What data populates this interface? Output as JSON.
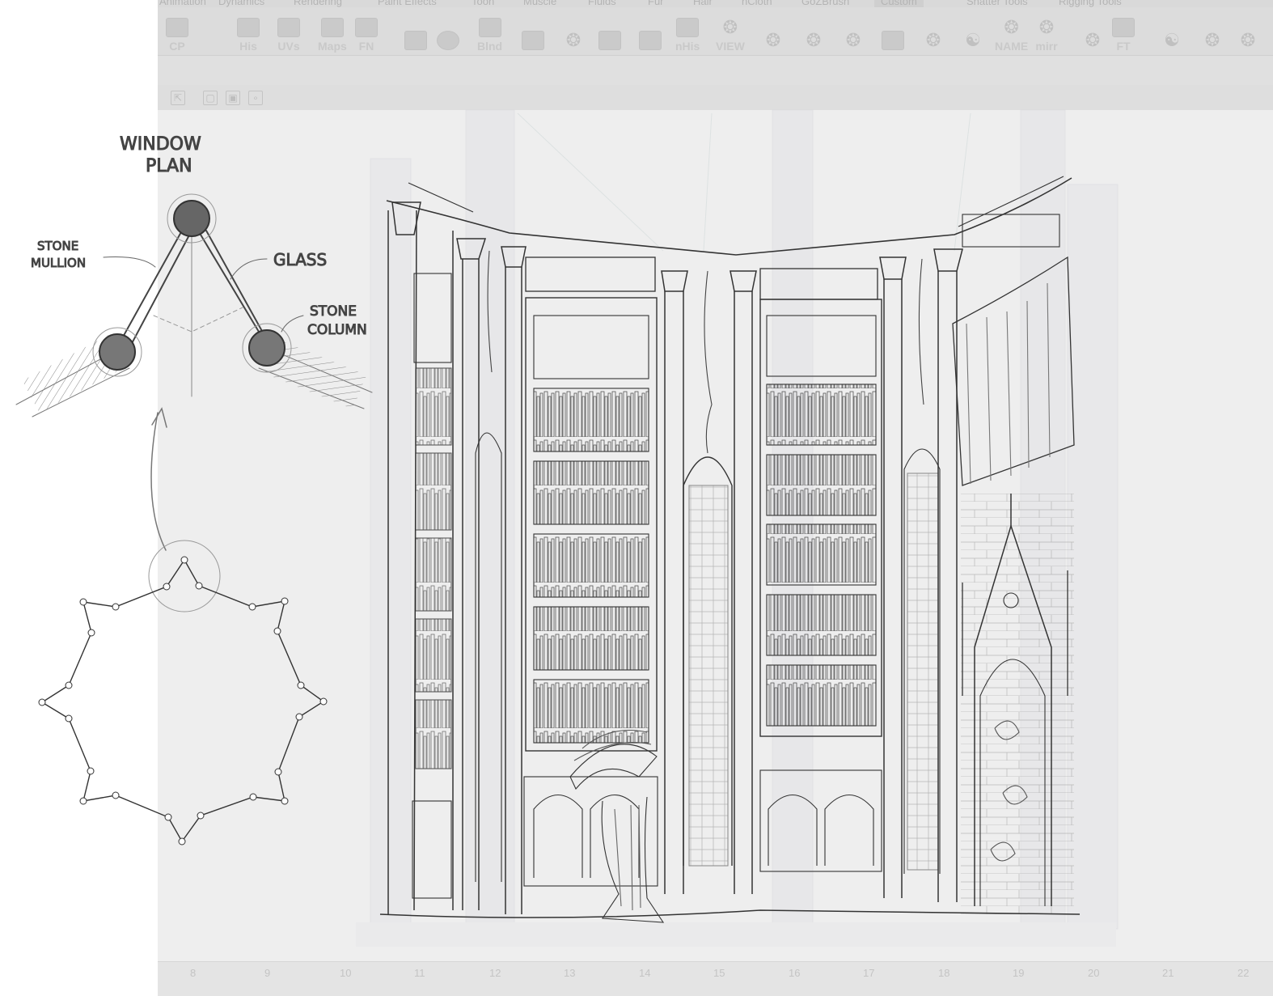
{
  "menu_tabs": [
    "Animation",
    "Dynamics",
    "Rendering",
    "Paint Effects",
    "Toon",
    "Muscle",
    "Fluids",
    "Fur",
    "Hair",
    "nCloth",
    "GoZBrush",
    "Custom",
    "Shatter Tools",
    "Rigging Tools"
  ],
  "shelf_labels": [
    "CP",
    "His",
    "UVs",
    "Maps",
    "FN",
    "Blnd",
    "nHis",
    "VIEW",
    "NAME",
    "mirr",
    "FT"
  ],
  "timeline_ticks": [
    "8",
    "9",
    "10",
    "11",
    "12",
    "13",
    "14",
    "15",
    "16",
    "17",
    "18",
    "19",
    "20",
    "21",
    "22"
  ],
  "annotations": {
    "window_plan_1": "WINDOW",
    "window_plan_2": "PLAN",
    "stone_mullion_1": "STONE",
    "stone_mullion_2": "MULLION",
    "glass": "GLASS",
    "stone_column_1": "STONE",
    "stone_column_2": "COLUMN"
  }
}
